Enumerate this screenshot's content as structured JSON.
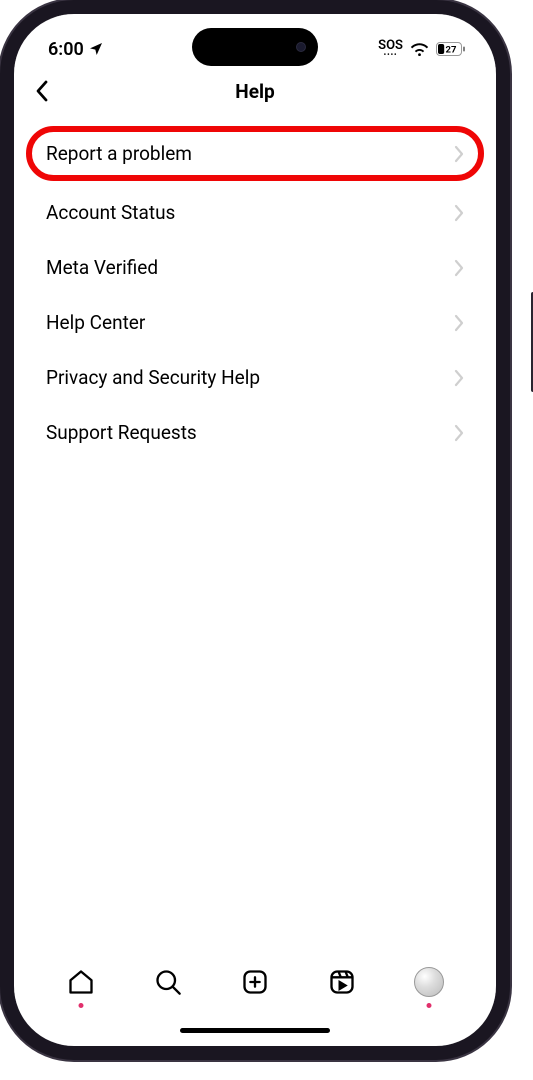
{
  "status_bar": {
    "time": "6:00",
    "sos_label": "SOS",
    "battery_level": "27"
  },
  "nav": {
    "title": "Help"
  },
  "menu": {
    "items": [
      {
        "label": "Report a problem",
        "highlighted": true
      },
      {
        "label": "Account Status"
      },
      {
        "label": "Meta Verified"
      },
      {
        "label": "Help Center"
      },
      {
        "label": "Privacy and Security Help"
      },
      {
        "label": "Support Requests"
      }
    ]
  },
  "bottom_tabs": [
    "home",
    "search",
    "create",
    "reels",
    "profile"
  ]
}
